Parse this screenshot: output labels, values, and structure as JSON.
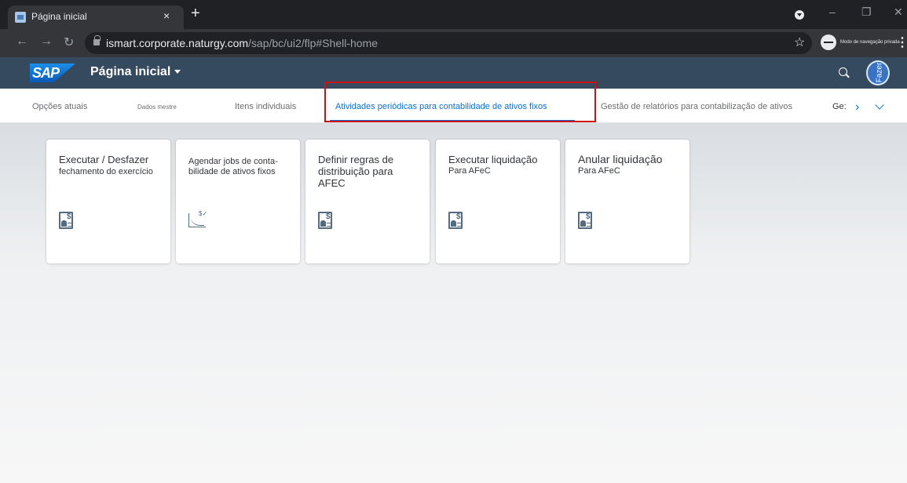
{
  "browser": {
    "tab_title": "Página inicial",
    "tab_close": "×",
    "new_tab": "+",
    "url_host": "ismart.corporate.naturgy.com",
    "url_path": "/sap/bc/ui2/flp#Shell-home",
    "incognito_label": "Modo de navegação privada",
    "icons": [
      "back-arrow-icon",
      "forward-arrow-icon",
      "reload-icon",
      "lock-icon",
      "star-icon",
      "incognito-icon",
      "menu-icon"
    ]
  },
  "shell": {
    "logo": "SAP",
    "title": "Página inicial",
    "user_initial": "Fazer",
    "colors": {
      "shellbar": "#354a5f",
      "accent": "#0a6ed1"
    }
  },
  "anchors": {
    "items": [
      "Opções atuais",
      "Dados mestre",
      "Itens individuais",
      "Atividades periódicas para contabilidade de ativos fixos",
      "Gestão de relatórios para contabilização de ativos",
      "Ge:"
    ],
    "active_index": 3
  },
  "tiles": [
    {
      "title": "Executar / Desfazer",
      "subtitle": "fechamento do exercício",
      "icon": "document-dollar-icon"
    },
    {
      "title": "Agendar jobs de conta-bilidade de ativos fixos",
      "subtitle": "",
      "icon": "chart-dollar-icon"
    },
    {
      "title": "Definir regras de distribuição para AFEC",
      "subtitle": "",
      "icon": "document-dollar-icon"
    },
    {
      "title": "Executar liquidação",
      "subtitle": "Para AFeC",
      "icon": "document-dollar-icon"
    },
    {
      "title": "Anular liquidação",
      "subtitle": "Para AFeC",
      "icon": "document-dollar-icon"
    }
  ]
}
